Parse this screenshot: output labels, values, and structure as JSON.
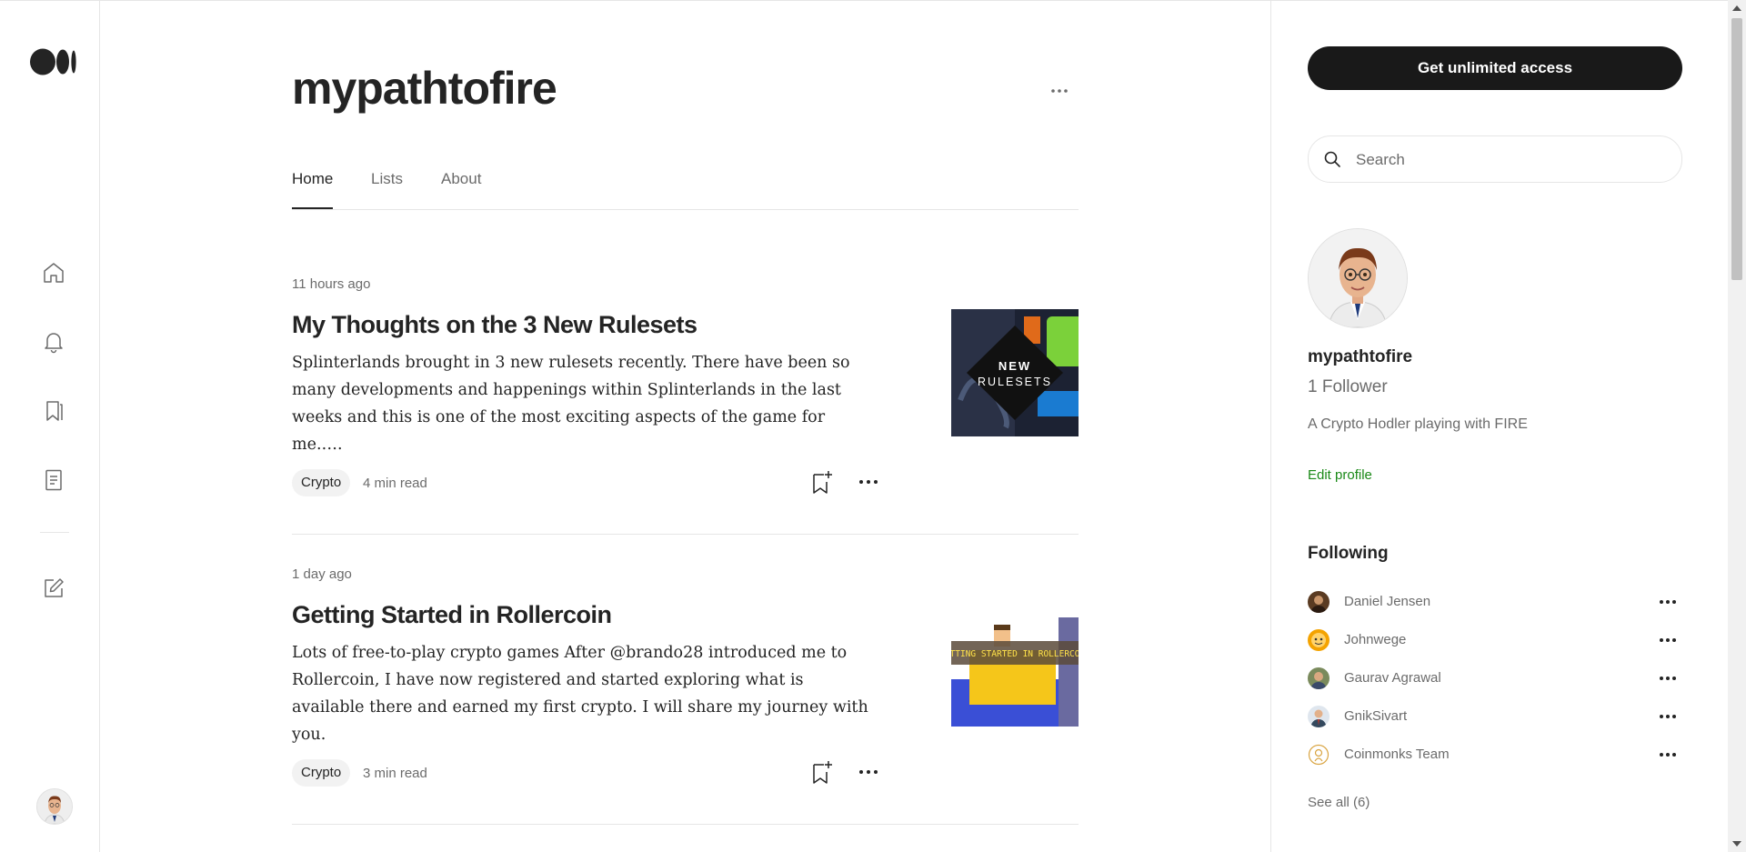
{
  "colors": {
    "text": "#242424",
    "muted": "#6b6b6b",
    "border": "#e6e6e6",
    "cta_bg": "#191919",
    "green_link": "#1a8917",
    "chip_bg": "#f2f2f2"
  },
  "rail": {
    "logo_icon": "medium-logo-icon",
    "items": [
      "home-icon",
      "notifications-bell-icon",
      "library-bookmark-icon",
      "stories-document-icon",
      "write-icon"
    ],
    "avatar_icon": "user-avatar"
  },
  "publication": {
    "title": "mypathtofire",
    "more_icon": "more-horizontal-icon",
    "tabs": [
      {
        "label": "Home",
        "active": true
      },
      {
        "label": "Lists",
        "active": false
      },
      {
        "label": "About",
        "active": false
      }
    ]
  },
  "posts": [
    {
      "time": "11 hours ago",
      "title": "My Thoughts on the 3 New Rulesets",
      "excerpt": "Splinterlands brought in 3 new rulesets recently. There have been so many developments and happenings within Splinterlands in the last weeks and this is one of the most exciting aspects of the game for me.….",
      "thumb_line1": "NEW",
      "thumb_line2": "RULESETS",
      "tag": "Crypto",
      "read_time": "4 min read"
    },
    {
      "time": "1 day ago",
      "title": "Getting Started in Rollercoin",
      "excerpt": "Lots of free-to-play crypto games After @brando28 introduced me to Rollercoin, I have now registered and started exploring what is available there and earned my first crypto. I will share my journey with you.",
      "thumb_line1": "GETTING STARTED IN ROLLERCOIN",
      "tag": "Crypto",
      "read_time": "3 min read"
    }
  ],
  "sidebar": {
    "cta_label": "Get unlimited access",
    "search_placeholder": "Search",
    "profile": {
      "name": "mypathtofire",
      "followers": "1 Follower",
      "bio": "A Crypto Hodler playing with FIRE",
      "edit_label": "Edit profile"
    },
    "following_title": "Following",
    "following": [
      {
        "name": "Daniel Jensen",
        "avatar_color": "#5a3b22"
      },
      {
        "name": "Johnwege",
        "avatar_color": "#f4a300"
      },
      {
        "name": "Gaurav Agrawal",
        "avatar_color": "#7a8a5c"
      },
      {
        "name": "GnikSivart",
        "avatar_color": "#34495e"
      },
      {
        "name": "Coinmonks Team",
        "avatar_color": "#d9a441"
      }
    ],
    "see_all_label": "See all (6)"
  }
}
